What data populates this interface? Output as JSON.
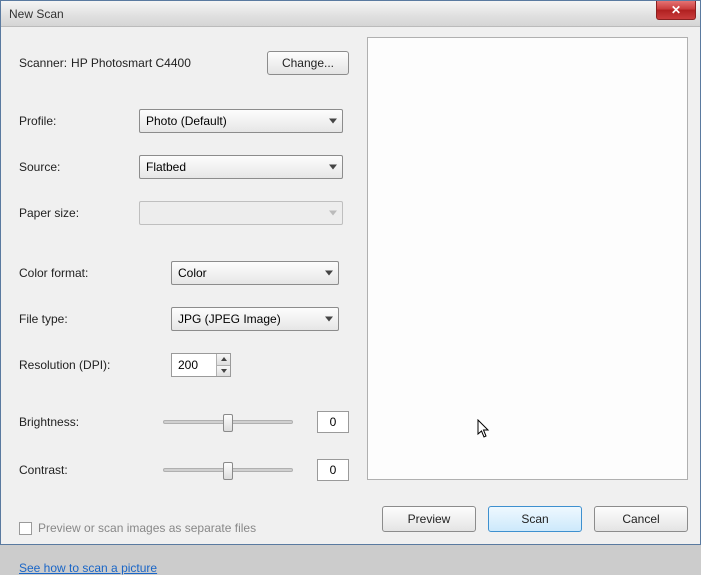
{
  "window_title": "New Scan",
  "scanner": {
    "label": "Scanner:",
    "name": "HP Photosmart C4400",
    "change_btn": "Change..."
  },
  "profile": {
    "label": "Profile:",
    "value": "Photo (Default)"
  },
  "source": {
    "label": "Source:",
    "value": "Flatbed"
  },
  "paper_size": {
    "label": "Paper size:",
    "value": ""
  },
  "color_format": {
    "label": "Color format:",
    "value": "Color"
  },
  "file_type": {
    "label": "File type:",
    "value": "JPG (JPEG Image)"
  },
  "resolution": {
    "label": "Resolution (DPI):",
    "value": "200"
  },
  "brightness": {
    "label": "Brightness:",
    "value": "0"
  },
  "contrast": {
    "label": "Contrast:",
    "value": "0"
  },
  "checkbox_label": "Preview or scan images as separate files",
  "help_link": "See how to scan a picture",
  "buttons": {
    "preview": "Preview",
    "scan": "Scan",
    "cancel": "Cancel"
  },
  "close_glyph": "✕"
}
